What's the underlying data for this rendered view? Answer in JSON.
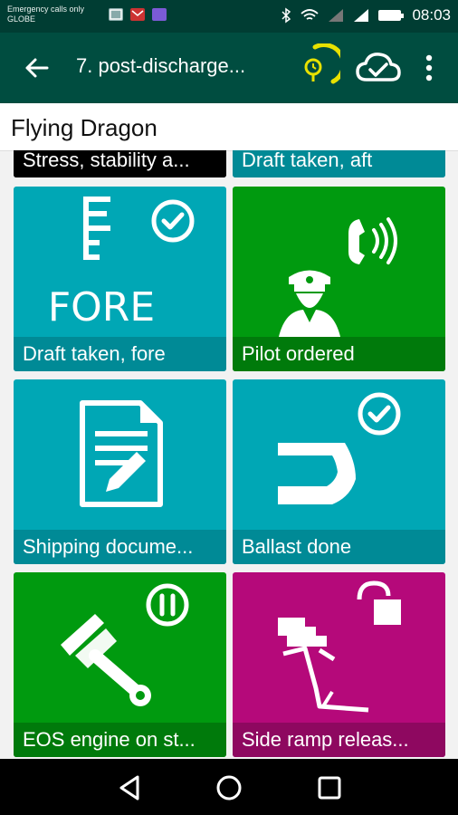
{
  "status_bar": {
    "carrier_line1": "Emergency calls only",
    "carrier_line2": "GLOBE",
    "time": "08:03"
  },
  "app_bar": {
    "title": "7. post-discharge...",
    "icons": [
      "back-arrow-icon",
      "progress-gauge-icon",
      "cloud-sync-icon",
      "more-vert-icon"
    ]
  },
  "ship": {
    "name": "Flying Dragon"
  },
  "tiles": [
    {
      "label": "Stress, stability a...",
      "color": "#000000"
    },
    {
      "label": "Draft taken, aft",
      "color": "#00a7b5"
    },
    {
      "label": "Draft taken, fore",
      "color": "#00a7b5",
      "icon": "draft-fore-icon",
      "icon_text": "FORE",
      "status": "check"
    },
    {
      "label": "Pilot ordered",
      "color": "#009a0f",
      "icon": "pilot-icon",
      "status": "phone"
    },
    {
      "label": "Shipping docume...",
      "color": "#00a7b5",
      "icon": "document-edit-icon"
    },
    {
      "label": "Ballast done",
      "color": "#00a7b5",
      "icon": "ballast-tank-icon",
      "status": "check"
    },
    {
      "label": "EOS engine on st...",
      "color": "#009a0f",
      "icon": "piston-icon",
      "status": "pause"
    },
    {
      "label": "Side ramp releas...",
      "color": "#b5097a",
      "icon": "side-ramp-icon",
      "status": "unlocked"
    }
  ],
  "nav_bar": {
    "icons": [
      "nav-back-icon",
      "nav-home-icon",
      "nav-recents-icon"
    ]
  }
}
